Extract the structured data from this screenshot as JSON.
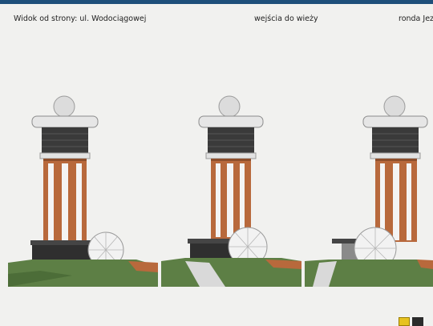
{
  "captions": {
    "left": "Widok od strony:  ul. Wodociągowej",
    "middle": "wejścia do wieży",
    "right": "ronda Jez"
  },
  "icons": [
    "logo-icon",
    "play-icon"
  ],
  "colors": {
    "topbar": "#1e4f7a",
    "background": "#f1f1ef",
    "grass": "#5d7f45",
    "brick": "#b8693c",
    "dark_band": "#3a3a3a"
  }
}
